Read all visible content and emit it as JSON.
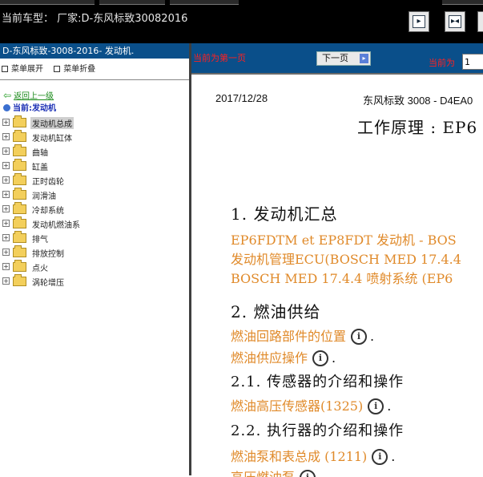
{
  "header": {
    "car_type": "当前车型： 厂家:D-东风标致30082016",
    "buttons": [
      {
        "name": "first",
        "glyph": "▶"
      },
      {
        "name": "prev-next",
        "glyph": "▶◀"
      },
      {
        "name": "last",
        "glyph": "▶"
      }
    ]
  },
  "sidebar": {
    "title": "D-东风标致-3008-2016- 发动机.",
    "expand_all": "菜单展开",
    "collapse_all": "菜单折叠",
    "back": "返回上一级",
    "current": "当前:发动机",
    "items": [
      {
        "label": "发动机总成"
      },
      {
        "label": "发动机缸体"
      },
      {
        "label": "曲轴"
      },
      {
        "label": "缸盖"
      },
      {
        "label": "正时齿轮"
      },
      {
        "label": "润滑油"
      },
      {
        "label": "冷却系统"
      },
      {
        "label": "发动机燃油系"
      },
      {
        "label": "排气"
      },
      {
        "label": "排放控制"
      },
      {
        "label": "点火"
      },
      {
        "label": "涡轮增压"
      }
    ]
  },
  "pager": {
    "first_page_msg": "当前为第一页",
    "next_label": "下一页",
    "current_label": "当前为",
    "page_value": "1"
  },
  "document": {
    "date": "2017/12/28",
    "model": "东风标致 3008 - D4EA0",
    "heading": "工作原理 : EP6",
    "section1": "1. 发动机汇总",
    "s1_links": [
      "EP6FDTM et EP8FDT 发动机 - BOS",
      "发动机管理ECU(BOSCH MED 17.4.4",
      "BOSCH MED 17.4.4 喷射系统 (EP6"
    ],
    "section2": "2. 燃油供给",
    "s2_links": [
      "燃油回路部件的位置",
      "燃油供应操作"
    ],
    "section21": "2.1. 传感器的介绍和操作",
    "s21_link": "燃油高压传感器(1325)",
    "section22": "2.2. 执行器的介绍和操作",
    "s22_links": [
      "燃油泵和表总成 (1211)",
      "高压燃油泵"
    ]
  },
  "colors": {
    "panel_blue": "#0a4f8a",
    "link_orange": "#e08a2a",
    "alert_red": "#ff2020"
  }
}
